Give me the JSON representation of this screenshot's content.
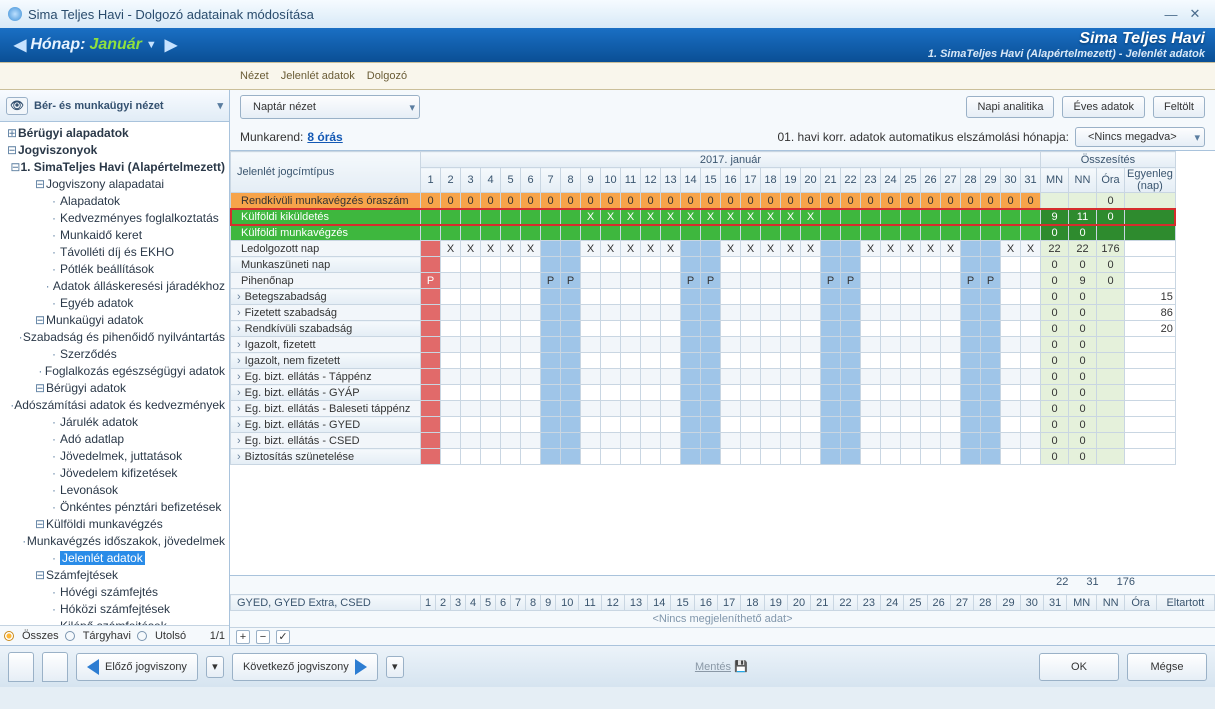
{
  "window": {
    "title": "Sima Teljes Havi - Dolgozó adatainak módosítása"
  },
  "monthbar": {
    "label": "Hónap:",
    "value": "Január",
    "app": "Sima Teljes Havi",
    "sub": "1. SimaTeljes Havi (Alapértelmezett) - Jelenlét adatok"
  },
  "menu2": [
    "Nézet",
    "Jelenlét adatok",
    "Dolgozó"
  ],
  "sidebar": {
    "viewLabel": "Bér- és munkaügyi nézet",
    "tree": [
      {
        "d": 0,
        "t": "+",
        "b": 1,
        "l": "Bérügyi alapadatok"
      },
      {
        "d": 0,
        "t": "−",
        "b": 1,
        "l": "Jogviszonyok"
      },
      {
        "d": 1,
        "t": "−",
        "b": 1,
        "l": "1. SimaTeljes Havi (Alapértelmezett)"
      },
      {
        "d": 2,
        "t": "−",
        "l": "Jogviszony alapadatai"
      },
      {
        "d": 3,
        "l": "Alapadatok"
      },
      {
        "d": 3,
        "l": "Kedvezményes foglalkoztatás"
      },
      {
        "d": 3,
        "l": "Munkaidő keret"
      },
      {
        "d": 3,
        "l": "Távolléti díj és EKHO"
      },
      {
        "d": 3,
        "l": "Pótlék beállítások"
      },
      {
        "d": 3,
        "l": "Adatok álláskeresési járadékhoz"
      },
      {
        "d": 3,
        "l": "Egyéb adatok"
      },
      {
        "d": 2,
        "t": "−",
        "l": "Munkaügyi adatok"
      },
      {
        "d": 3,
        "l": "Szabadság és pihenőidő nyilvántartás"
      },
      {
        "d": 3,
        "l": "Szerződés"
      },
      {
        "d": 3,
        "l": "Foglalkozás egészségügyi adatok"
      },
      {
        "d": 2,
        "t": "−",
        "l": "Bérügyi adatok"
      },
      {
        "d": 3,
        "l": "Adószámítási adatok és kedvezmények"
      },
      {
        "d": 3,
        "l": "Járulék adatok"
      },
      {
        "d": 3,
        "l": "Adó adatlap"
      },
      {
        "d": 3,
        "l": "Jövedelmek, juttatások"
      },
      {
        "d": 3,
        "l": "Jövedelem kifizetések"
      },
      {
        "d": 3,
        "l": "Levonások"
      },
      {
        "d": 3,
        "l": "Önkéntes pénztári befizetések"
      },
      {
        "d": 2,
        "t": "−",
        "l": "Külföldi munkavégzés"
      },
      {
        "d": 3,
        "l": "Munkavégzés időszakok, jövedelmek"
      },
      {
        "d": 3,
        "l": "Jelenlét adatok",
        "sel": 1
      },
      {
        "d": 2,
        "t": "−",
        "l": "Számfejtések"
      },
      {
        "d": 3,
        "l": "Hóvégi számfejtés"
      },
      {
        "d": 3,
        "l": "Hóközi számfejtések"
      },
      {
        "d": 3,
        "l": "Kilépő számfejtések"
      },
      {
        "d": 3,
        "l": "Táppénz számfejtések"
      }
    ],
    "radios": {
      "osszes": "Összes",
      "targyhavi": "Tárgyhavi",
      "utolso": "Utolsó",
      "count": "1/1"
    }
  },
  "toolbar": {
    "naptar": "Naptár nézet",
    "napi": "Napi analitika",
    "eves": "Éves adatok",
    "feltolt": "Feltölt"
  },
  "info": {
    "munkarend": "Munkarend:",
    "ora": "8 órás",
    "korr": "01. havi korr. adatok automatikus elszámolási hónapja:",
    "nincs": "<Nincs megadva>"
  },
  "grid": {
    "monthTitle": "2017. január",
    "sumTitle": "Összesítés",
    "typeHdr": "Jelenlét jogcímtípus",
    "days": [
      1,
      2,
      3,
      4,
      5,
      6,
      7,
      8,
      9,
      10,
      11,
      12,
      13,
      14,
      15,
      16,
      17,
      18,
      19,
      20,
      21,
      22,
      23,
      24,
      25,
      26,
      27,
      28,
      29,
      30,
      31
    ],
    "weekend": [
      1,
      7,
      8,
      14,
      15,
      21,
      22,
      28,
      29
    ],
    "sumCols": [
      "MN",
      "NN",
      "Óra",
      "Egyenleg (nap)"
    ],
    "rows": [
      {
        "name": "Rendkívüli munkavégzés óraszám",
        "style": "orange",
        "cells": {
          "all": "0"
        },
        "sum": [
          "",
          "",
          "0",
          ""
        ]
      },
      {
        "name": "Külföldi kiküldetés",
        "style": "green",
        "redbox": 1,
        "cells": {
          "9": "X",
          "10": "X",
          "11": "X",
          "12": "X",
          "13": "X",
          "14": "X",
          "15": "X",
          "16": "X",
          "17": "X",
          "18": "X",
          "19": "X",
          "20": "X"
        },
        "sum": [
          "9",
          "11",
          "0",
          ""
        ],
        "sumStyle": "dgreen"
      },
      {
        "name": "Külföldi munkavégzés",
        "style": "green",
        "cells": {},
        "sum": [
          "0",
          "0",
          "",
          ""
        ],
        "sumStyle": "dgreen"
      },
      {
        "name": "Ledolgozott nap",
        "exp": 0,
        "alt": 1,
        "cells": {
          "2": "X",
          "3": "X",
          "4": "X",
          "5": "X",
          "6": "X",
          "9": "X",
          "10": "X",
          "11": "X",
          "12": "X",
          "13": "X",
          "16": "X",
          "17": "X",
          "18": "X",
          "19": "X",
          "20": "X",
          "23": "X",
          "24": "X",
          "25": "X",
          "26": "X",
          "27": "X",
          "30": "X",
          "31": "X"
        },
        "weCol": "blue",
        "d1": "redP",
        "sum": [
          "22",
          "22",
          "176",
          ""
        ]
      },
      {
        "name": "Munkaszüneti nap",
        "exp": 0,
        "cells": {},
        "d1": "redP",
        "weCol": "blue",
        "sum": [
          "0",
          "0",
          "0",
          ""
        ]
      },
      {
        "name": "Pihenőnap",
        "exp": 0,
        "alt": 1,
        "cells": {
          "7": "P",
          "8": "P",
          "14": "P",
          "15": "P",
          "21": "P",
          "22": "P",
          "28": "P",
          "29": "P"
        },
        "cellStyle": "blue",
        "d1": "redP",
        "d1v": "P",
        "sum": [
          "0",
          "9",
          "0",
          ""
        ]
      },
      {
        "name": "Betegszabadság",
        "exp": 1,
        "cells": {},
        "d1": "redP",
        "weCol": "blue",
        "sum": [
          "0",
          "0",
          "",
          "15"
        ]
      },
      {
        "name": "Fizetett szabadság",
        "exp": 1,
        "alt": 1,
        "cells": {},
        "d1": "redP",
        "weCol": "blue",
        "sum": [
          "0",
          "0",
          "",
          "86"
        ]
      },
      {
        "name": "Rendkívüli szabadság",
        "exp": 1,
        "cells": {},
        "d1": "redP",
        "weCol": "blue",
        "sum": [
          "0",
          "0",
          "",
          "20"
        ]
      },
      {
        "name": "Igazolt, fizetett",
        "exp": 1,
        "alt": 1,
        "side": 1,
        "cells": {},
        "d1": "redP",
        "weCol": "blue",
        "sum": [
          "0",
          "0",
          "",
          ""
        ]
      },
      {
        "name": "Igazolt, nem fizetett",
        "exp": 1,
        "cells": {},
        "d1": "redP",
        "weCol": "blue",
        "sum": [
          "0",
          "0",
          "",
          ""
        ]
      },
      {
        "name": "Eg. bizt. ellátás - Táppénz",
        "exp": 1,
        "alt": 1,
        "cells": {},
        "d1": "redP",
        "weCol": "blue",
        "sum": [
          "0",
          "0",
          "",
          ""
        ]
      },
      {
        "name": "Eg. bizt. ellátás - GYÁP",
        "exp": 1,
        "cells": {},
        "d1": "redP",
        "weCol": "blue",
        "sum": [
          "0",
          "0",
          "",
          ""
        ]
      },
      {
        "name": "Eg. bizt. ellátás - Baleseti táppénz",
        "exp": 1,
        "alt": 1,
        "cells": {},
        "d1": "redP",
        "weCol": "blue",
        "sum": [
          "0",
          "0",
          "",
          ""
        ]
      },
      {
        "name": "Eg. bizt. ellátás - GYED",
        "exp": 1,
        "cells": {},
        "d1": "redP",
        "weCol": "blue",
        "sum": [
          "0",
          "0",
          "",
          ""
        ]
      },
      {
        "name": "Eg. bizt. ellátás - CSED",
        "exp": 1,
        "alt": 1,
        "cells": {},
        "d1": "redP",
        "weCol": "blue",
        "sum": [
          "0",
          "0",
          "",
          ""
        ]
      },
      {
        "name": "Biztosítás szünetelése",
        "exp": 1,
        "cells": {},
        "d1": "redP",
        "weCol": "blue",
        "sum": [
          "0",
          "0",
          "",
          ""
        ]
      }
    ],
    "totals": [
      "22",
      "31",
      "176"
    ],
    "footerLabel": "GYED, GYED Extra, CSED",
    "footerSumCols": [
      "MN",
      "NN",
      "Óra",
      "Eltartott"
    ],
    "nodata": "<Nincs megjeleníthető adat>"
  },
  "bottom": {
    "prev": "Előző jogviszony",
    "next": "Következő jogviszony",
    "save": "Mentés",
    "ok": "OK",
    "cancel": "Mégse"
  }
}
